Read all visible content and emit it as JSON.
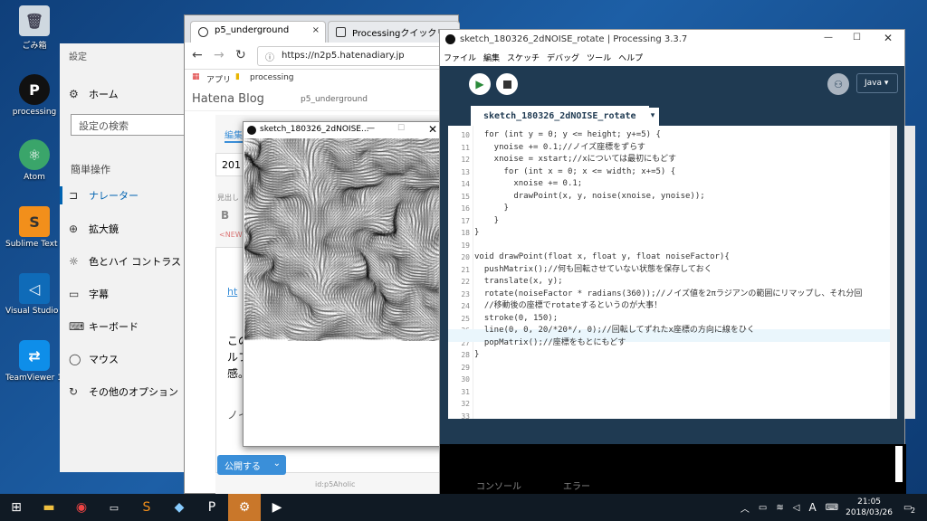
{
  "desktop_icons": [
    {
      "label": "ごみ箱",
      "icon": "recycle-bin-icon"
    },
    {
      "label": "processing",
      "icon": "processing-icon"
    },
    {
      "label": "Atom",
      "icon": "atom-icon"
    },
    {
      "label": "Sublime Text 3",
      "icon": "sublime-icon"
    },
    {
      "label": "Visual Studio Co",
      "icon": "vscode-icon"
    },
    {
      "label": "TeamViewer 13",
      "icon": "teamviewer-icon"
    }
  ],
  "settings": {
    "title": "設定",
    "home": "ホーム",
    "search_placeholder": "設定の検索",
    "section": "簡単操作",
    "items": [
      "ナレーター",
      "拡大鏡",
      "色とハイ コントラスト",
      "字幕",
      "キーボード",
      "マウス",
      "その他のオプション"
    ]
  },
  "chrome": {
    "tab1": "p5_underground",
    "tab2": "Processingクイックリファレ",
    "url": "https://n2p5.hatenadiary.jp",
    "bookmarks": [
      "アプリ",
      "processing"
    ],
    "blog_brand": "Hatena Blog",
    "blog_name": "p5_underground",
    "edit_tab": "編集",
    "date_frag": "201",
    "heading_frag": "見出し",
    "bold": "B",
    "new_frag": "<NEW",
    "link_frag": "ht",
    "text1": "この",
    "text2": "ルフ",
    "text3": "感。",
    "text4": "ノイ",
    "text1r": "間空",
    "text2r": "やれ",
    "text3r": "がす",
    "text4r": "た",
    "publish": "公開する",
    "footer_frag": "id:p5Aholic"
  },
  "sketch": {
    "title": "sketch_180326_2dNOISE..."
  },
  "pde": {
    "title": "sketch_180326_2dNOISE_rotate | Processing 3.3.7",
    "menu": [
      "ファイル",
      "編集",
      "スケッチ",
      "デバッグ",
      "ツール",
      "ヘルプ"
    ],
    "mode": "Java ▾",
    "tab": "sketch_180326_2dNOISE_rotate",
    "lines": [
      {
        "n": "10",
        "code": "  for (int y = 0; y <= height; y+=5) {"
      },
      {
        "n": "11",
        "code": "    ynoise += 0.1;//ノイズ座標をずらす"
      },
      {
        "n": "12",
        "code": "    xnoise = xstart;//xについては最初にもどす"
      },
      {
        "n": "13",
        "code": "      for (int x = 0; x <= width; x+=5) {"
      },
      {
        "n": "14",
        "code": "        xnoise += 0.1;"
      },
      {
        "n": "15",
        "code": "        drawPoint(x, y, noise(xnoise, ynoise));"
      },
      {
        "n": "16",
        "code": "      }"
      },
      {
        "n": "17",
        "code": "    }"
      },
      {
        "n": "18",
        "code": "}"
      },
      {
        "n": "19",
        "code": ""
      },
      {
        "n": "20",
        "code": "void drawPoint(float x, float y, float noiseFactor){"
      },
      {
        "n": "21",
        "code": "  pushMatrix();//何も回転させていない状態を保存しておく"
      },
      {
        "n": "22",
        "code": "  translate(x, y);"
      },
      {
        "n": "23",
        "code": "  rotate(noiseFactor * radians(360));//ノイズ値を2πラジアンの範囲にリマップし、それ分回"
      },
      {
        "n": "24",
        "code": "  //移動後の座標でrotateするというのが大事！"
      },
      {
        "n": "25",
        "code": "  stroke(0, 150);"
      },
      {
        "n": "26",
        "code": "  line(0, 0, 20/*20*/, 0);//回転してずれたx座標の方向に線をひく"
      },
      {
        "n": "27",
        "code": "  popMatrix();//座標をもとにもどす"
      },
      {
        "n": "28",
        "code": "}"
      },
      {
        "n": "29",
        "code": ""
      },
      {
        "n": "30",
        "code": ""
      },
      {
        "n": "31",
        "code": ""
      },
      {
        "n": "32",
        "code": ""
      },
      {
        "n": "33",
        "code": ""
      }
    ],
    "console_tab": "コンソール",
    "error_tab": "エラー"
  },
  "taskbar": {
    "time": "21:05",
    "date": "2018/03/26",
    "notif": "2",
    "ime": "A"
  }
}
